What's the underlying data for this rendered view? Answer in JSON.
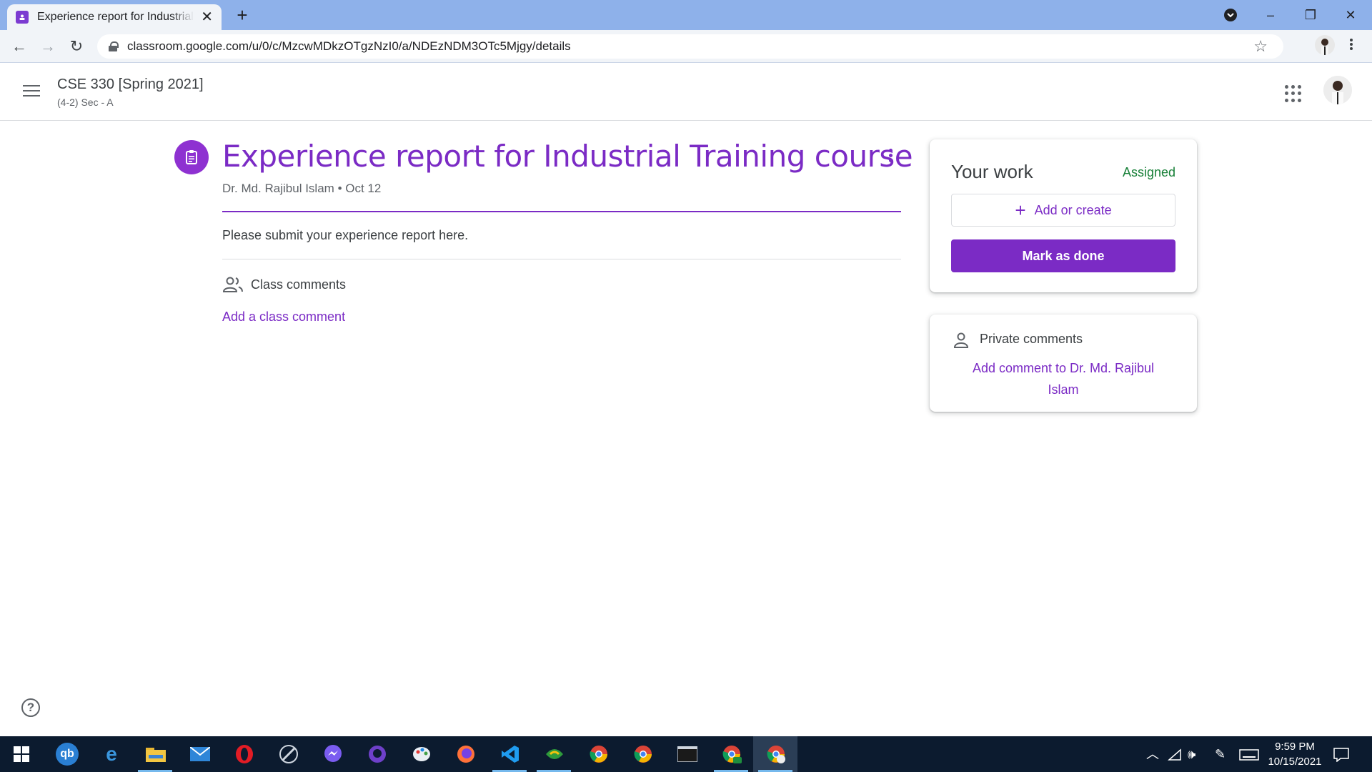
{
  "browser": {
    "tab_title": "Experience report for Industrial Training course",
    "url": "classroom.google.com/u/0/c/MzcwMDkzOTgzNzI0/a/NDEzNDM3OTc5Mjgy/details",
    "window_controls": [
      "–",
      "❐",
      "✕"
    ]
  },
  "header": {
    "course_title": "CSE 330 [Spring 2021]",
    "course_section": "(4-2) Sec - A"
  },
  "assignment": {
    "title": "Experience report for Industrial Training course",
    "author": "Dr. Md. Rajibul Islam",
    "separator": "•",
    "date": "Oct 12",
    "instructions": "Please submit your experience report here.",
    "class_comments_label": "Class comments",
    "add_class_comment": "Add a class comment"
  },
  "your_work": {
    "title": "Your work",
    "status": "Assigned",
    "add_or_create": "Add or create",
    "mark_as_done": "Mark as done"
  },
  "private_comments": {
    "label": "Private comments",
    "add_comment_line1": "Add comment to Dr. Md. Rajibul",
    "add_comment_line2": "Islam"
  },
  "colors": {
    "accent": "#7b2bc5",
    "status_green": "#188038",
    "taskbar": "#0c1b2f"
  },
  "taskbar": {
    "icons": [
      "start-icon",
      "quickbooks-icon",
      "edge-icon",
      "file-explorer-icon",
      "mail-icon",
      "opera-icon",
      "satellite-app-icon",
      "messenger-icon",
      "github-desktop-icon",
      "paint-icon",
      "firefox-icon",
      "vscode-icon",
      "codeblocks-icon",
      "chrome-profile-icon",
      "chrome-icon",
      "terminal-icon",
      "chrome-ek-icon",
      "chrome-active-icon"
    ],
    "time": "9:59 PM",
    "date": "10/15/2021"
  }
}
